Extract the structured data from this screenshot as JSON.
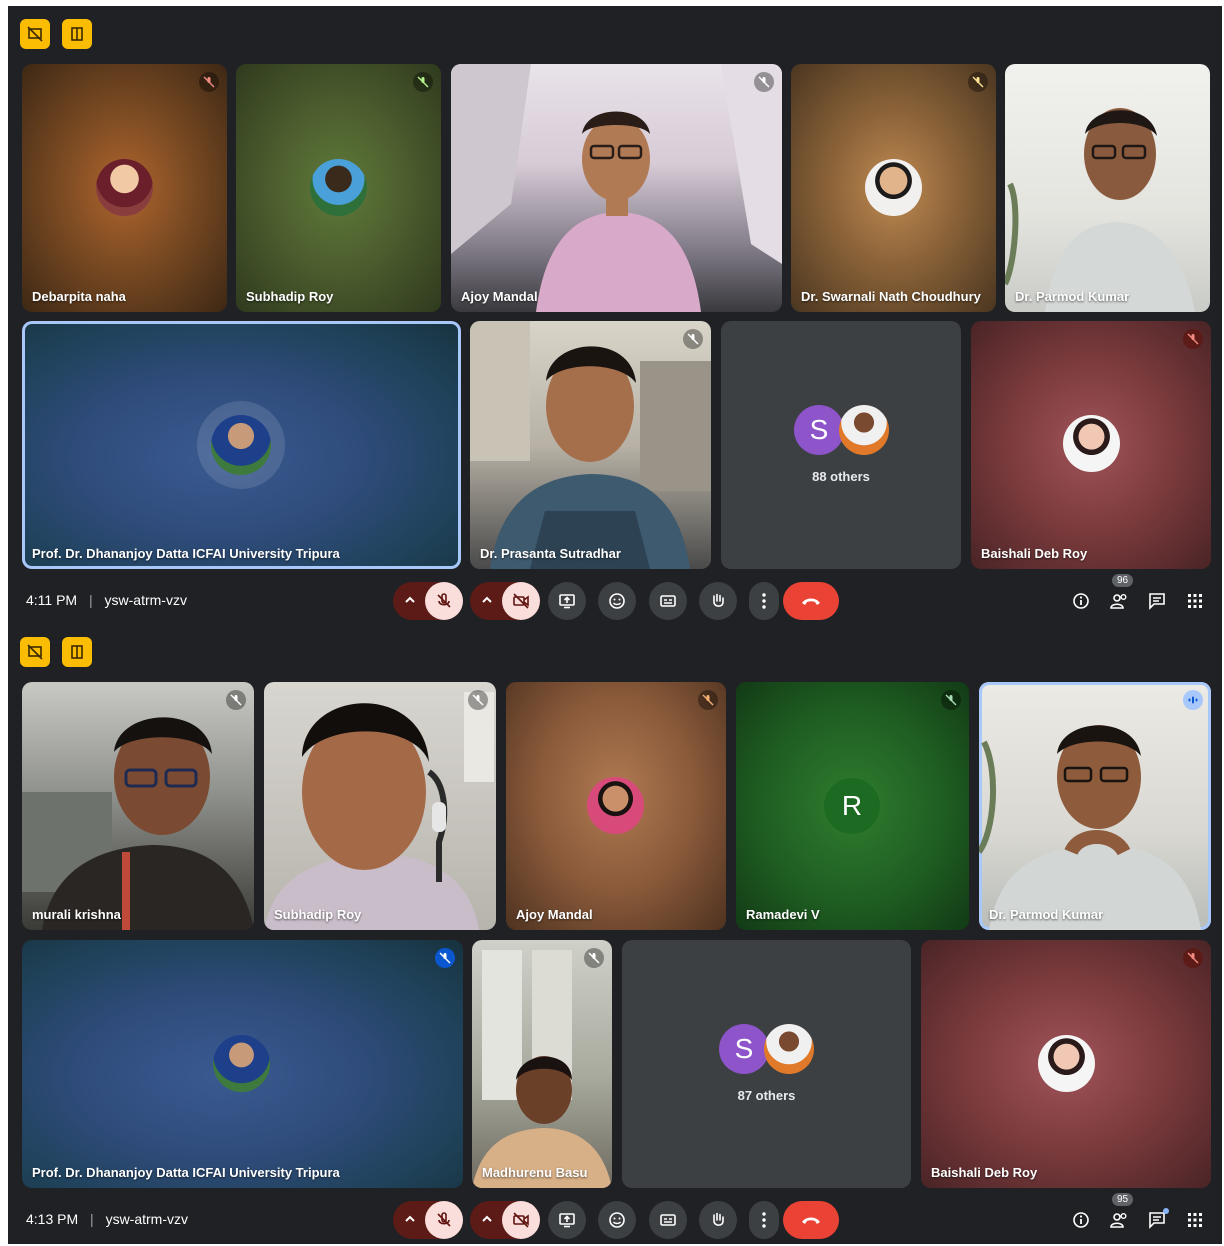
{
  "colors": {
    "bg": "#202124",
    "accent": "#fbbc04",
    "end_call": "#ea4335",
    "active_border": "#a8c7fa"
  },
  "screens": [
    {
      "time": "4:11 PM",
      "separator": "|",
      "meeting_code": "ysw-atrm-vzv",
      "people_count": "96",
      "row1": [
        {
          "name": "Debarpita naha",
          "mic": "muted"
        },
        {
          "name": "Subhadip Roy",
          "mic": "muted"
        },
        {
          "name": "Ajoy Mandal",
          "mic": "muted"
        },
        {
          "name": "Dr. Swarnali Nath Choudhury",
          "mic": "muted"
        },
        {
          "name": "Dr. Parmod Kumar",
          "mic": "none"
        }
      ],
      "row2": [
        {
          "name": "Prof. Dr. Dhananjoy Datta ICFAI University Tripura",
          "mic": "none"
        },
        {
          "name": "Dr. Prasanta Sutradhar",
          "mic": "muted"
        },
        {
          "others_letter": "S",
          "others_label": "88 others"
        },
        {
          "name": "Baishali Deb Roy",
          "mic": "muted-red"
        }
      ]
    },
    {
      "time": "4:13 PM",
      "separator": "|",
      "meeting_code": "ysw-atrm-vzv",
      "people_count": "95",
      "row1": [
        {
          "name": "murali krishna",
          "mic": "muted"
        },
        {
          "name": "Subhadip Roy",
          "mic": "muted"
        },
        {
          "name": "Ajoy Mandal",
          "mic": "muted"
        },
        {
          "name": "Ramadevi V",
          "letter": "R",
          "mic": "muted"
        },
        {
          "name": "Dr. Parmod Kumar",
          "mic": "speaking"
        }
      ],
      "row2": [
        {
          "name": "Prof. Dr. Dhananjoy Datta ICFAI University Tripura",
          "mic": "muted-blue"
        },
        {
          "name": "Madhurenu Basu",
          "mic": "muted"
        },
        {
          "others_letter": "S",
          "others_label": "87 others"
        },
        {
          "name": "Baishali Deb Roy",
          "mic": "muted-red"
        }
      ]
    }
  ],
  "icons": [
    "presentation-off-icon",
    "layout-icon",
    "mic-off-icon",
    "camera-off-icon",
    "present-screen-icon",
    "emoji-icon",
    "captions-icon",
    "raise-hand-icon",
    "more-options-icon",
    "end-call-icon",
    "info-icon",
    "people-icon",
    "chat-icon",
    "activities-icon",
    "chevron-up-icon"
  ]
}
